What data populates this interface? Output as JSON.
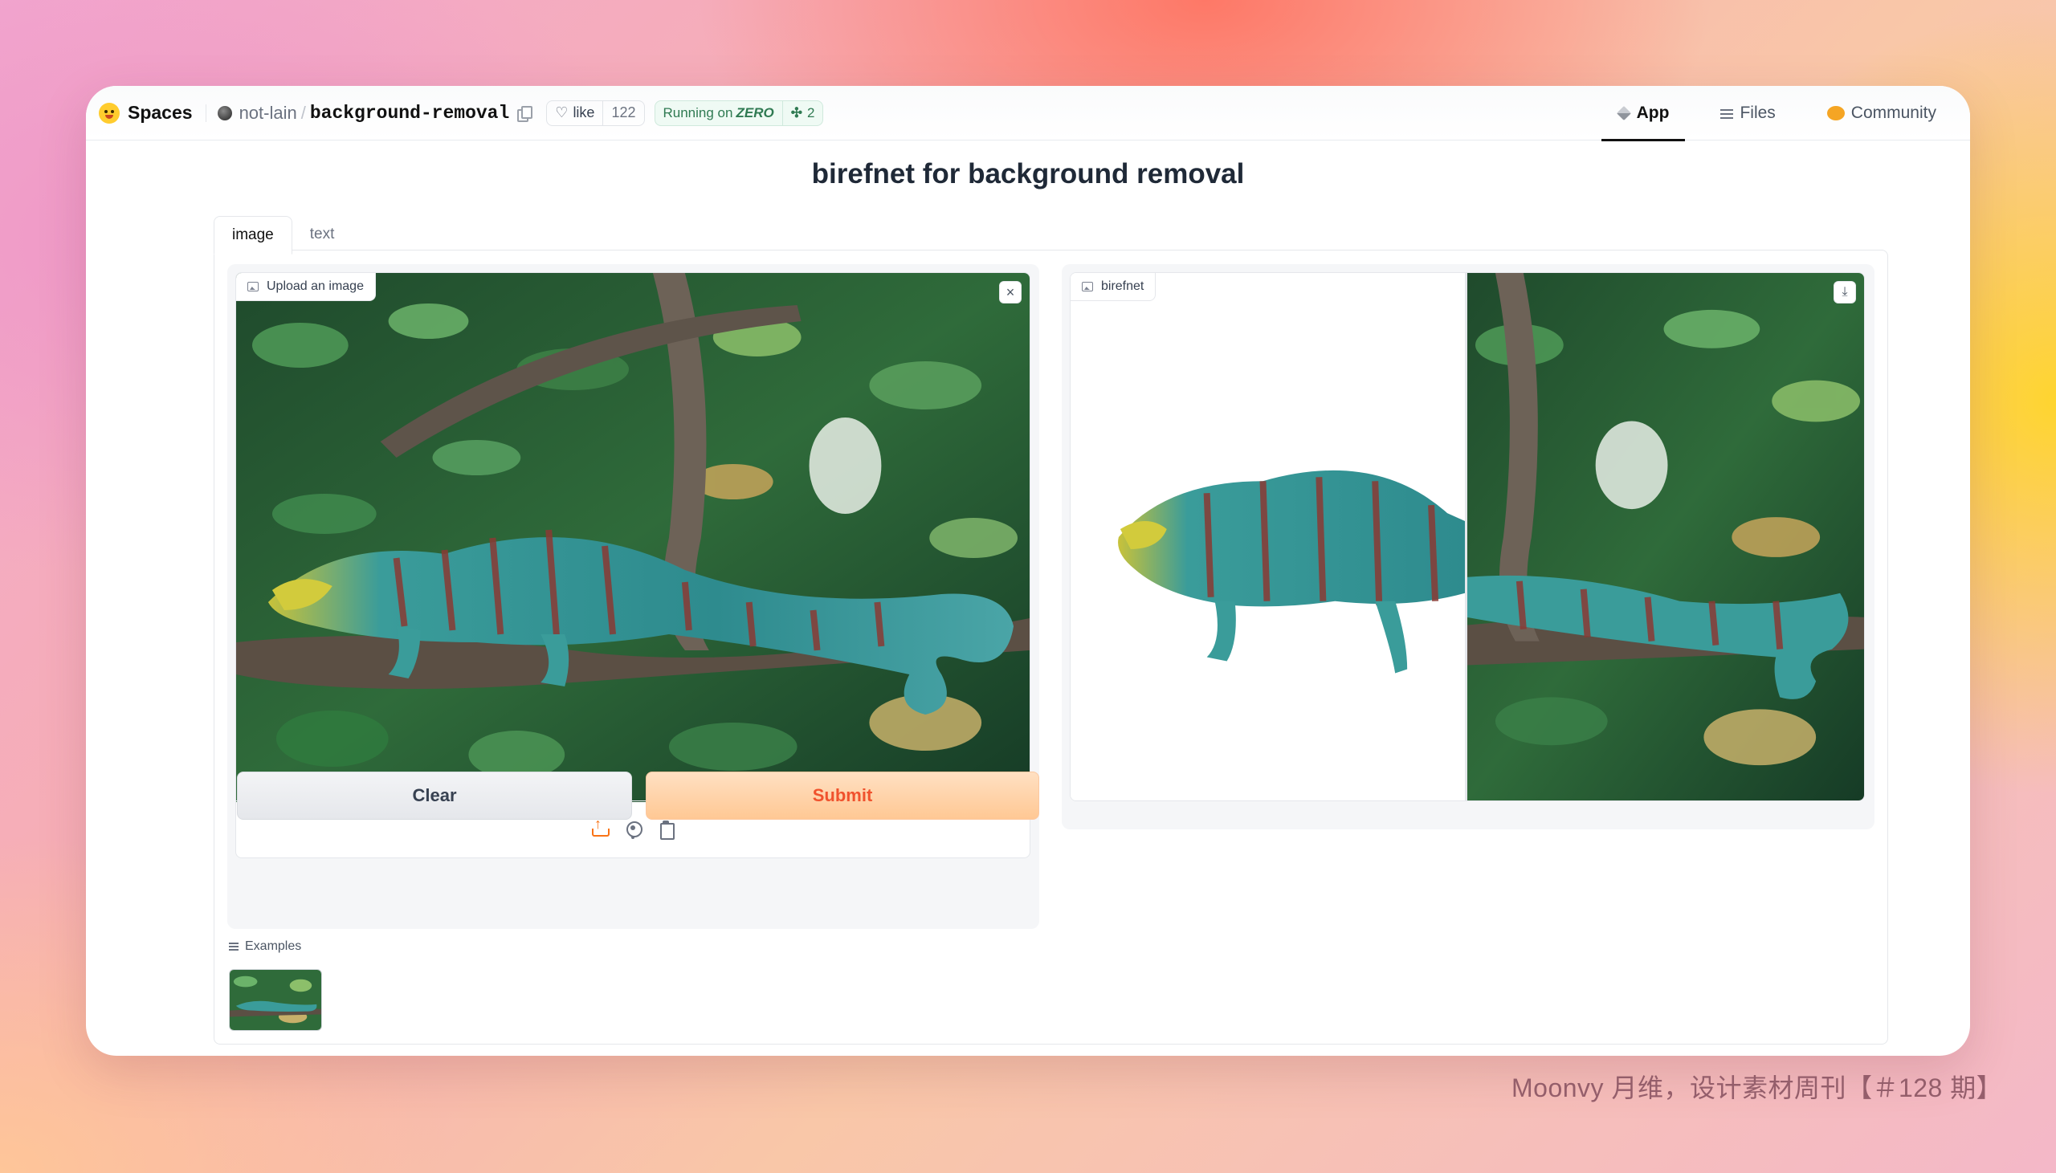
{
  "header": {
    "brand": "Spaces",
    "owner": "not-lain",
    "repo": "background-removal",
    "like_label": "like",
    "like_count": "122",
    "running_label": "Running on",
    "running_hw": "ZERO",
    "replicas": "2",
    "tabs": [
      {
        "label": "App",
        "icon": "cube-icon",
        "active": true
      },
      {
        "label": "Files",
        "icon": "files-icon",
        "active": false
      },
      {
        "label": "Community",
        "icon": "community-icon",
        "active": false
      }
    ]
  },
  "page": {
    "title": "birefnet for background removal",
    "tabs": [
      {
        "label": "image",
        "active": true
      },
      {
        "label": "text",
        "active": false
      }
    ]
  },
  "input": {
    "label": "Upload an image",
    "close_icon": "close-icon",
    "sources": [
      "upload-icon",
      "webcam-icon",
      "clipboard-icon"
    ]
  },
  "output": {
    "label": "birefnet",
    "download_icon": "download-icon"
  },
  "actions": {
    "clear_label": "Clear",
    "submit_label": "Submit"
  },
  "examples": {
    "label": "Examples"
  },
  "watermark": "Moonvy 月维，设计素材周刊【＃128 期】",
  "colors": {
    "accent": "#f97316",
    "submit_text": "#f0522d",
    "running_green": "#2f7a52"
  }
}
